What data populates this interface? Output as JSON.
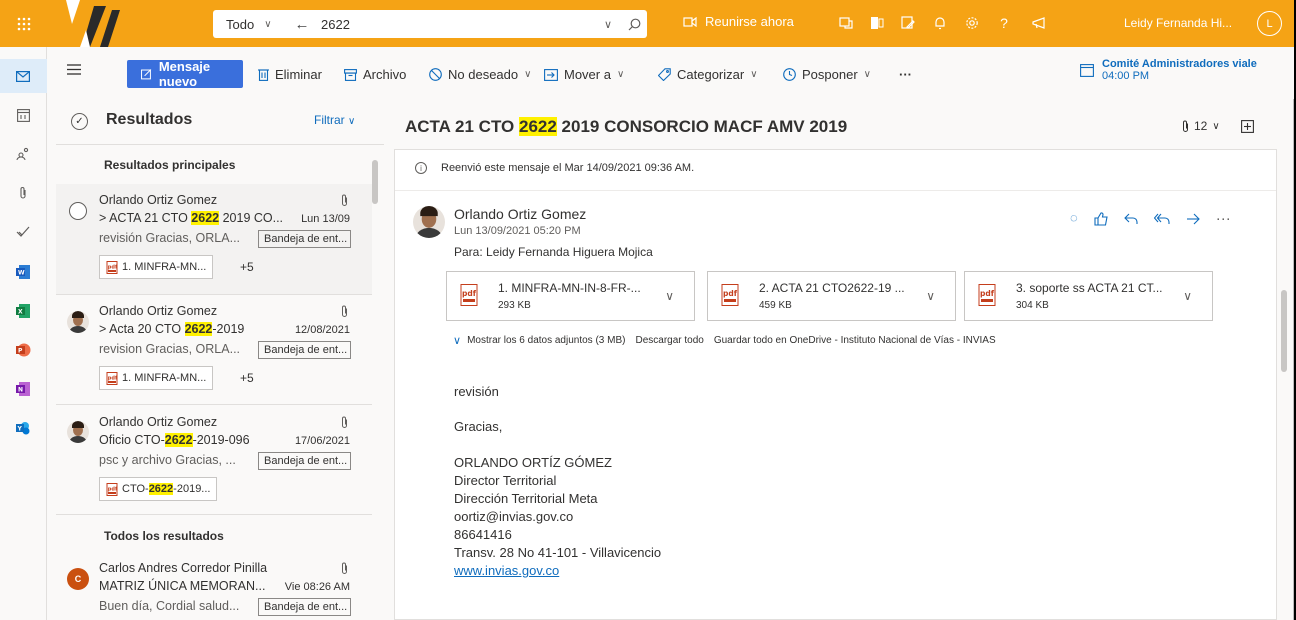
{
  "topbar": {
    "search_scope": "Todo",
    "search_query": "2622",
    "meet_now": "Reunirse ahora",
    "user_name": "Leidy Fernanda Hi...",
    "user_initial": "L",
    "icons": [
      "app-launcher-icon",
      "teams-icon",
      "office-icon",
      "my-day-icon",
      "bell-icon",
      "gear-icon",
      "help-icon",
      "feedback-icon"
    ]
  },
  "rail": {
    "items": [
      "mail-icon",
      "calendar-icon",
      "people-icon",
      "attach-icon",
      "todo-icon",
      "word-icon",
      "excel-icon",
      "powerpoint-icon",
      "onenote-icon",
      "yammer-icon"
    ]
  },
  "commands": {
    "new_message": "Mensaje nuevo",
    "delete": "Eliminar",
    "archive": "Archivo",
    "junk": "No deseado",
    "move": "Mover a",
    "categorize": "Categorizar",
    "snooze": "Posponer",
    "more": "···",
    "reminder_title": "Comité Administradores viale",
    "reminder_time": "04:00 PM"
  },
  "list": {
    "title": "Resultados",
    "filter": "Filtrar",
    "top_section": "Resultados principales",
    "all_section": "Todos los resultados",
    "items": [
      {
        "sender": "Orlando Ortiz Gomez",
        "subject_pre": "> ACTA 21 CTO ",
        "subject_hl": "2622",
        "subject_post": " 2019 CO...",
        "date": "Lun 13/09",
        "preview": "revisión Gracias, ORLA...",
        "folder": "Bandeja de ent...",
        "attachment_pre": "1. MINFRA-MN...",
        "attachment_hl": "",
        "attachment_post": "",
        "more": "+5"
      },
      {
        "sender": "Orlando Ortiz Gomez",
        "subject_pre": "> Acta 20 CTO ",
        "subject_hl": "2622",
        "subject_post": "-2019",
        "date": "12/08/2021",
        "preview": "revision Gracias, ORLA...",
        "folder": "Bandeja de ent...",
        "attachment_pre": "1. MINFRA-MN...",
        "attachment_hl": "",
        "attachment_post": "",
        "more": "+5"
      },
      {
        "sender": "Orlando Ortiz Gomez",
        "subject_pre": "Oficio CTO-",
        "subject_hl": "2622",
        "subject_post": "-2019-096",
        "date": "17/06/2021",
        "preview": "psc y archivo Gracias, ...",
        "folder": "Bandeja de ent...",
        "attachment_pre": "CTO-",
        "attachment_hl": "2622",
        "attachment_post": "-2019...",
        "more": ""
      },
      {
        "sender": "Carlos Andres Corredor Pinilla",
        "subject_pre": "MATRIZ ÚNICA MEMORAN...",
        "subject_hl": "",
        "subject_post": "",
        "date": "Vie 08:26 AM",
        "preview": "Buen día, Cordial salud...",
        "folder": "Bandeja de ent...",
        "initial": "C"
      }
    ]
  },
  "reading": {
    "subject_pre": "ACTA 21 CTO ",
    "subject_hl": "2622",
    "subject_post": " 2019 CONSORCIO MACF AMV 2019",
    "count": "12",
    "forward_note": "Reenvió este mensaje el Mar 14/09/2021 09:36 AM.",
    "from": "Orlando Ortiz Gomez",
    "date": "Lun 13/09/2021 05:20 PM",
    "to": "Para:  Leidy Fernanda Higuera Mojica",
    "attachments": [
      {
        "name": "1. MINFRA-MN-IN-8-FR-...",
        "size": "293 KB"
      },
      {
        "name": "2. ACTA 21 CTO2622-19 ...",
        "size": "459 KB"
      },
      {
        "name": "3. soporte ss ACTA 21 CT...",
        "size": "304 KB"
      }
    ],
    "show_all": "Mostrar los 6 datos adjuntos (3 MB)",
    "download_all": "Descargar todo",
    "save_onedrive": "Guardar todo en OneDrive - Instituto Nacional de Vías - INVIAS",
    "body": {
      "line1": "revisión",
      "line2": "Gracias,",
      "sig_name": "ORLANDO ORTÍZ GÓMEZ",
      "sig_title": "Director Territorial",
      "sig_dept": "Dirección Territorial Meta",
      "sig_email": "oortiz@invias.gov.co",
      "sig_phone": "86641416",
      "sig_address": "Transv. 28 No 41-101 - Villavicencio",
      "sig_web": "www.invias.gov.co"
    }
  },
  "colors": {
    "topbar": "#f5a315",
    "primary": "#3a6fdc",
    "highlight": "#fff100"
  }
}
